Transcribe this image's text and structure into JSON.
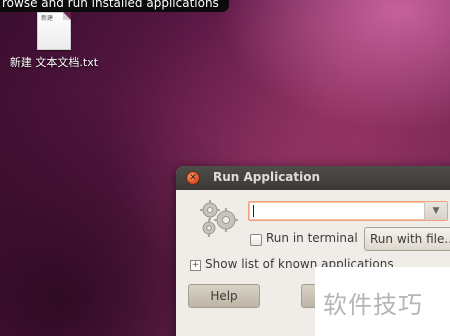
{
  "tooltip": {
    "text": "rowse and run installed applications"
  },
  "desktop": {
    "file": {
      "icon": "text-file-icon",
      "thumb_text": "新建",
      "label": "新建 文本文档.txt"
    }
  },
  "dialog": {
    "title": "Run Application",
    "icons": {
      "close": "close-icon",
      "gears": "gears-icon",
      "dropdown": "chevron-down-icon",
      "expander": "plus-icon"
    },
    "command_value": "",
    "run_in_terminal": {
      "label": "Run in terminal",
      "checked": false
    },
    "run_with_file_label": "Run with file...",
    "show_list_label": "Show list of known applications",
    "help_label": "Help"
  },
  "watermark": {
    "text": "软件技巧"
  },
  "colors": {
    "titlebar": "#3c3b37",
    "close_button": "#e2572c",
    "dialog_bg": "#f0ede9",
    "focus_border": "#f0a07a"
  }
}
